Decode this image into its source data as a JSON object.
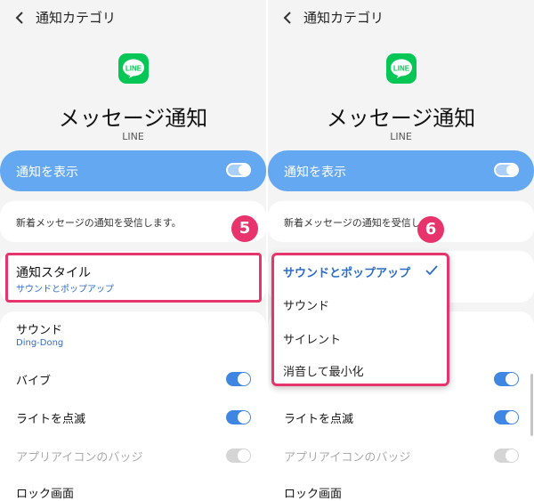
{
  "header": {
    "title": "通知カテゴリ"
  },
  "app": {
    "title": "メッセージ通知",
    "name": "LINE",
    "icon": "line-app-icon",
    "icon_text": "LINE",
    "brand_color": "#06c755"
  },
  "show_notifications": {
    "label": "通知を表示",
    "enabled": true
  },
  "description": {
    "text": "新着メッセージの通知を受信します。",
    "text_truncated": "新着メッセージの通知を受信しま"
  },
  "notification_style": {
    "label": "通知スタイル",
    "value": "サウンドとポップアップ"
  },
  "sound": {
    "label": "サウンド",
    "value": "Ding-Dong"
  },
  "vibrate": {
    "label": "バイブ",
    "enabled": true
  },
  "light_blink": {
    "label": "ライトを点滅",
    "enabled": true
  },
  "app_badge": {
    "label": "アプリアイコンのバッジ",
    "enabled": true,
    "disabled": true
  },
  "lock_screen": {
    "label": "ロック画面"
  },
  "steps": {
    "left": "5",
    "right": "6"
  },
  "style_dropdown": {
    "options": [
      "サウンドとポップアップ",
      "サウンド",
      "サイレント",
      "消音して最小化"
    ],
    "selected_index": 0
  },
  "colors": {
    "accent": "#3e86e2",
    "highlight_row": "#65a8f2",
    "annotation": "#e8346d",
    "link": "#2b6cc9"
  }
}
